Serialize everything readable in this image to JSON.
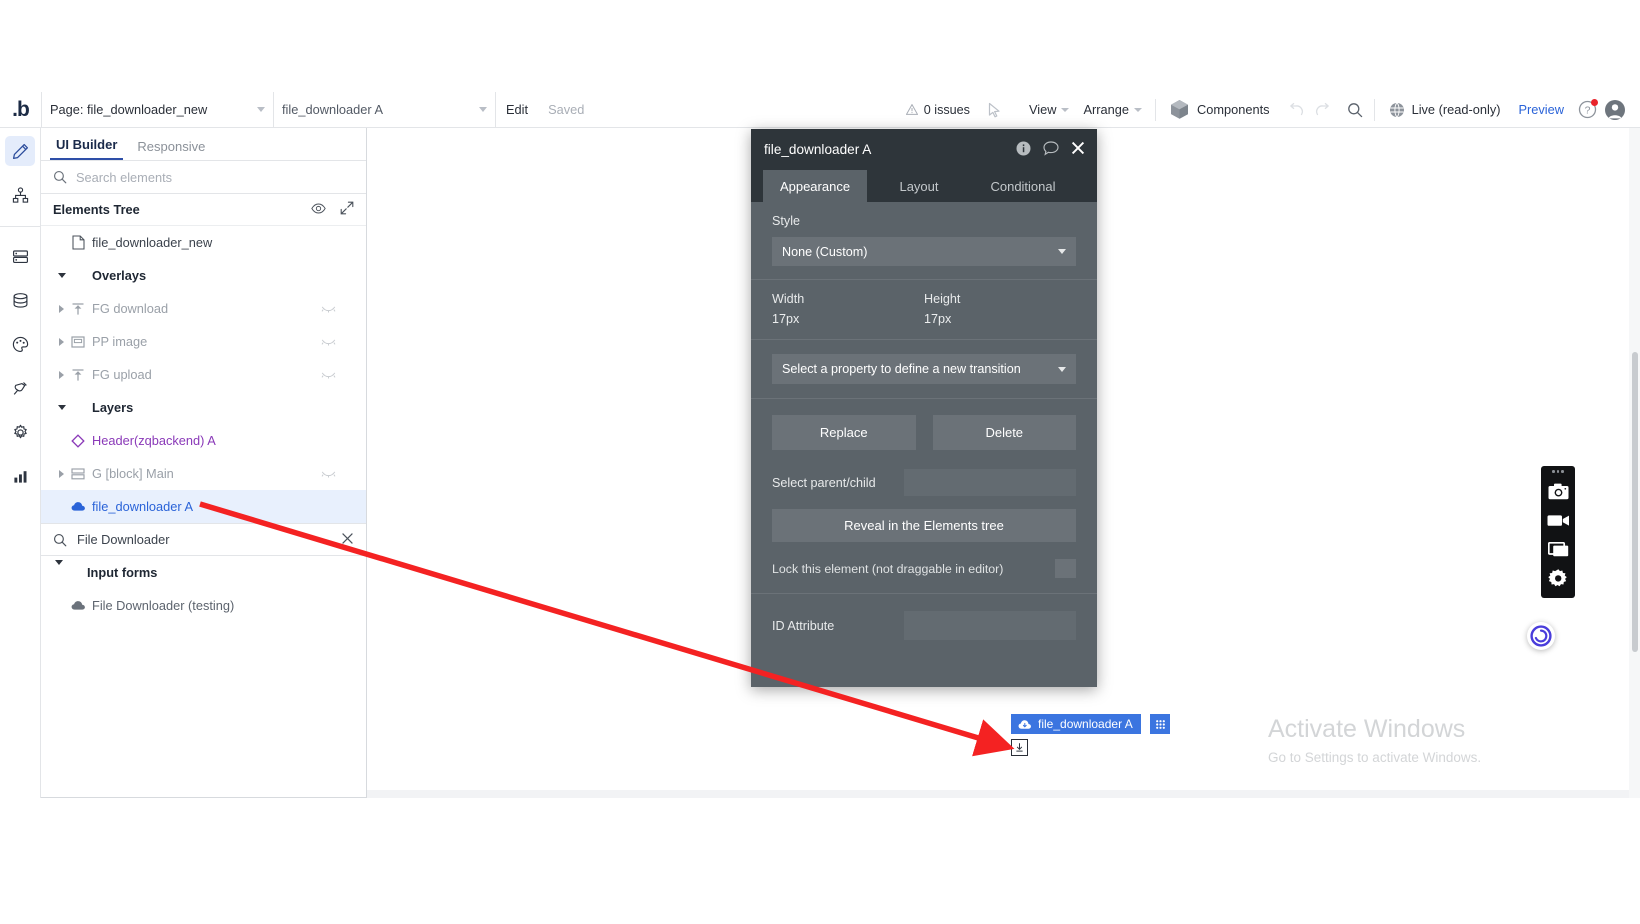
{
  "topbar": {
    "logo": ".b",
    "page_select": "Page: file_downloader_new",
    "element_select": "file_downloader A",
    "edit_label": "Edit",
    "saved_label": "Saved",
    "issues": "0 issues",
    "view_label": "View",
    "arrange_label": "Arrange",
    "components_label": "Components",
    "live_label": "Live (read-only)",
    "preview_label": "Preview"
  },
  "rail": {
    "items": [
      {
        "name": "design-pencil",
        "active": true
      },
      {
        "name": "workflow-tree",
        "active": false
      },
      {
        "name": "data-rows",
        "active": false
      },
      {
        "name": "database",
        "active": false
      },
      {
        "name": "styles-palette",
        "active": false
      },
      {
        "name": "plugins-plug",
        "active": false
      },
      {
        "name": "settings-gear",
        "active": false
      },
      {
        "name": "logs-chart",
        "active": false
      }
    ]
  },
  "panel": {
    "tabs": [
      {
        "label": "UI Builder",
        "active": true
      },
      {
        "label": "Responsive",
        "active": false
      }
    ],
    "search_placeholder": "Search elements",
    "tree_header": "Elements Tree",
    "tree": [
      {
        "label": "file_downloader_new",
        "icon": "page-icon",
        "depth": 0,
        "style": "dark",
        "expander": "none",
        "hidden_eye": false
      },
      {
        "label": "Overlays",
        "icon": "none",
        "depth": 0,
        "style": "bold",
        "expander": "down",
        "hidden_eye": false
      },
      {
        "label": "FG download",
        "icon": "float-group-icon",
        "depth": 1,
        "style": "grey",
        "expander": "right",
        "hidden_eye": true
      },
      {
        "label": "PP image",
        "icon": "popup-icon",
        "depth": 1,
        "style": "grey",
        "expander": "right",
        "hidden_eye": true
      },
      {
        "label": "FG upload",
        "icon": "float-group-icon",
        "depth": 1,
        "style": "grey",
        "expander": "right",
        "hidden_eye": true
      },
      {
        "label": "Layers",
        "icon": "none",
        "depth": 0,
        "style": "bold",
        "expander": "down",
        "hidden_eye": false
      },
      {
        "label": "Header(zqbackend) A",
        "icon": "reusable-diamond-icon",
        "depth": 1,
        "style": "purple",
        "expander": "none",
        "hidden_eye": false
      },
      {
        "label": "G [block] Main",
        "icon": "group-block-icon",
        "depth": 1,
        "style": "grey",
        "expander": "right",
        "hidden_eye": true
      },
      {
        "label": "file_downloader A",
        "icon": "cloud-download-icon",
        "depth": 1,
        "style": "selected",
        "expander": "none",
        "hidden_eye": false
      }
    ],
    "filter": {
      "value": "File Downloader"
    },
    "group_label": "Input forms",
    "group_items": [
      {
        "label": "File Downloader (testing)",
        "icon": "cloud-download-icon"
      }
    ]
  },
  "dialog": {
    "title": "file_downloader A",
    "tabs": [
      {
        "label": "Appearance",
        "active": true
      },
      {
        "label": "Layout",
        "active": false
      },
      {
        "label": "Conditional",
        "active": false
      }
    ],
    "style_label": "Style",
    "style_value": "None (Custom)",
    "width_label": "Width",
    "width_value": "17px",
    "height_label": "Height",
    "height_value": "17px",
    "transition_placeholder": "Select a property to define a new transition",
    "replace_label": "Replace",
    "delete_label": "Delete",
    "select_parent_child_label": "Select parent/child",
    "select_parent_child_value": "",
    "reveal_label": "Reveal in the Elements tree",
    "lock_label": "Lock this element (not draggable in editor)",
    "id_attribute_label": "ID Attribute",
    "id_attribute_value": ""
  },
  "canvas": {
    "selected_badge": "file_downloader A"
  },
  "watermark": {
    "title": "Activate Windows",
    "subtitle": "Go to Settings to activate Windows."
  },
  "rec_widget": {
    "items": [
      "camera-icon",
      "video-camera-icon",
      "window-capture-icon",
      "gear-icon"
    ]
  },
  "colors": {
    "accent_blue": "#2a63d8",
    "selection_blue": "#3b75e0",
    "dialog_bg": "#5b6369",
    "dialog_header": "#2e353a",
    "annotation_red": "#f42222",
    "purple": "#8a39b8"
  }
}
